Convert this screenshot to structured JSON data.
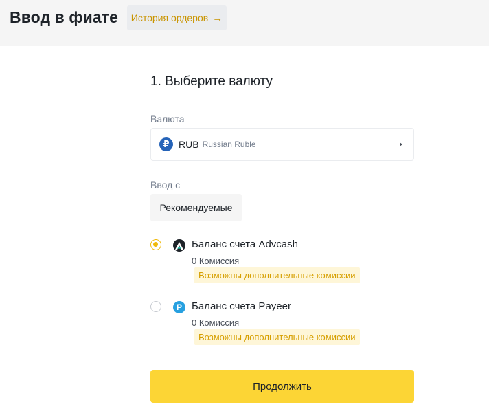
{
  "header": {
    "title": "Ввод в фиате",
    "history_label": "История ордеров",
    "history_arrow": "→"
  },
  "step": {
    "title": "1. Выберите валюту"
  },
  "currency": {
    "label": "Валюта",
    "code": "RUB",
    "name": "Russian Ruble",
    "icon": "ruble-icon",
    "icon_glyph": "₽"
  },
  "deposit": {
    "label": "Ввод с",
    "tab_label": "Рекомендуемые"
  },
  "methods": [
    {
      "name": "Баланс счета Advcash",
      "fee": "0 Комиссия",
      "note": "Возможны дополнительные комиссии",
      "selected": true,
      "icon": "advcash-icon"
    },
    {
      "name": "Баланс счета Payeer",
      "fee": "0 Комиссия",
      "note": "Возможны дополнительные комиссии",
      "selected": false,
      "icon": "payeer-icon",
      "icon_glyph": "P"
    }
  ],
  "actions": {
    "continue_label": "Продолжить"
  },
  "colors": {
    "accent": "#fcd535",
    "accent_text": "#c99400",
    "note_bg": "#fef6d8"
  }
}
